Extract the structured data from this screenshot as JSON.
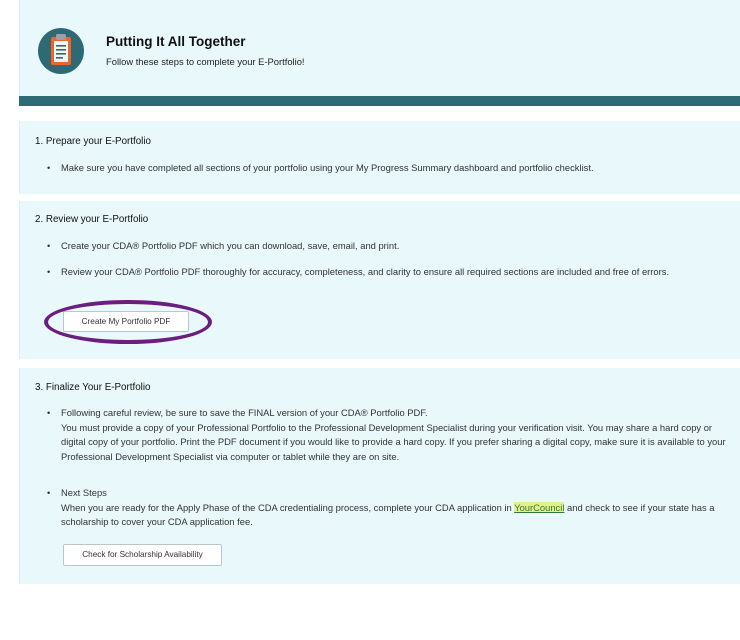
{
  "header": {
    "title": "Putting It All Together",
    "subtitle": "Follow these steps to complete your E-Portfolio!",
    "icon": "clipboard-icon"
  },
  "sections": [
    {
      "title": "1. Prepare your E-Portfolio",
      "bullets": [
        "Make sure you have completed all sections of your portfolio using your My Progress Summary dashboard and portfolio checklist."
      ]
    },
    {
      "title": "2. Review your E-Portfolio",
      "bullets": [
        "Create your CDA® Portfolio PDF which you can download, save, email, and print.",
        "Review your CDA® Portfolio PDF thoroughly for accuracy, completeness, and clarity to ensure all required sections are included and free of errors."
      ],
      "button_label": "Create My Portfolio PDF"
    },
    {
      "title": "3. Finalize Your E-Portfolio",
      "bullet1_line1": "Following careful review, be sure to save the FINAL version of your CDA® Portfolio PDF.",
      "bullet1_line2": "You must provide a copy of your Professional Portfolio to the Professional Development Specialist during your verification visit. You may share a hard copy or digital copy of your portfolio. Print the PDF document if you would like to provide a hard copy. If you prefer sharing a digital copy, make sure it is available to your Professional Development Specialist via computer or tablet while they are on site.",
      "bullet2_heading": "Next Steps",
      "bullet2_before_link": "When you are ready for the Apply Phase of the CDA credentialing process, complete your CDA application in ",
      "bullet2_link": "YourCouncil",
      "bullet2_after_link": " and check to see if your state has a scholarship to cover your CDA application fee.",
      "button_label": "Check for Scholarship Availability"
    }
  ],
  "colors": {
    "panel_bg": "#e9f8fb",
    "header_bar": "#2e6b75",
    "highlight_ring": "#6a1e7f",
    "link": "#2f7a3a"
  }
}
